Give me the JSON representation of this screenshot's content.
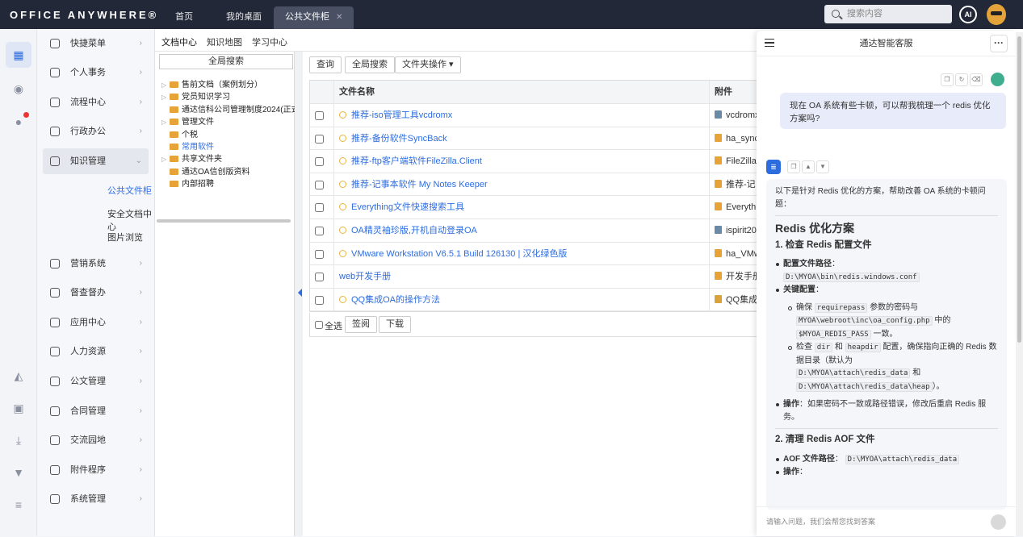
{
  "app": {
    "logo": "OFFICE ANYWHERE®",
    "tabs": [
      "首页",
      "我的桌面",
      "公共文件柜"
    ],
    "active_tab": "公共文件柜",
    "search_placeholder": "搜索内容",
    "ai_label": "AI"
  },
  "menu": {
    "items": [
      {
        "label": "快捷菜单"
      },
      {
        "label": "个人事务"
      },
      {
        "label": "流程中心"
      },
      {
        "label": "行政办公"
      },
      {
        "label": "知识管理"
      },
      {
        "label": "营销系统"
      },
      {
        "label": "督查督办"
      },
      {
        "label": "应用中心"
      },
      {
        "label": "人力资源"
      },
      {
        "label": "公文管理"
      },
      {
        "label": "合同管理"
      },
      {
        "label": "交流园地"
      },
      {
        "label": "附件程序"
      },
      {
        "label": "系统管理"
      }
    ],
    "sub_items": [
      "公共文件柜",
      "安全文档中心",
      "图片浏览"
    ]
  },
  "subtabs": [
    "文档中心",
    "知识地图",
    "学习中心"
  ],
  "tree": {
    "global_search": "全局搜索",
    "nodes": [
      "售前文档（案例划分）",
      "党员知识学习",
      "通达信科公司管理制度2024(正式",
      "管理文件",
      "个税",
      "常用软件",
      "共享文件夹",
      "通达OA信创版资料",
      "内部招聘"
    ]
  },
  "toolbar": {
    "query": "查询",
    "global_search": "全局搜索",
    "folder_ops": "文件夹操作 ▾"
  },
  "table": {
    "headers": [
      "文件名称",
      "附件"
    ],
    "rows": [
      {
        "name": "推荐-iso管理工具vcdromx",
        "att": "vcdromx"
      },
      {
        "name": "推荐-备份软件SyncBack",
        "att": "ha_sync"
      },
      {
        "name": "推荐-ftp客户端软件FileZilla.Client",
        "att": "FileZilla."
      },
      {
        "name": "推荐-记事本软件 My Notes Keeper",
        "att": "推荐-记"
      },
      {
        "name": "Everything文件快速搜索工具",
        "att": "Everythi"
      },
      {
        "name": "OA精灵袖珍版,开机自动登录OA",
        "att": "ispirit20"
      },
      {
        "name": "VMware Workstation V6.5.1 Build 126130 | 汉化绿色版",
        "att": "ha_VMw"
      },
      {
        "name": "web开发手册",
        "att": "开发手册"
      },
      {
        "name": "QQ集成OA的操作方法",
        "att": "QQ集成"
      }
    ],
    "select_all": "全选",
    "sign": "签阅",
    "download": "下载"
  },
  "chat": {
    "title": "通达智能客服",
    "user_msg": "现在 OA 系统有些卡顿，可以帮我梳理一个 redis 优化方案吗?",
    "bot_intro": "以下是针对 Redis 优化的方案，帮助改善 OA 系统的卡顿问题：",
    "h1": "Redis 优化方案",
    "s1_title": "1. 检查 Redis 配置文件",
    "cfg_path_label": "配置文件路径",
    "cfg_path": "D:\\MYOA\\bin\\redis.windows.conf",
    "key_cfg": "关键配置",
    "b1_pre": "确保",
    "b1_code1": "requirepass",
    "b1_mid": "参数的密码与",
    "b1_code2": "MYOA\\webroot\\inc\\oa_config.php",
    "b1_mid2": "中的",
    "b1_code3": "$MYOA_REDIS_PASS",
    "b1_end": "一致。",
    "b2_pre": "检查",
    "b2_code1": "dir",
    "b2_and": "和",
    "b2_code2": "heapdir",
    "b2_mid": "配置，确保指向正确的 Redis 数据目录（默认为",
    "b2_code3": "D:\\MYOA\\attach\\redis_data",
    "b2_and2": "和",
    "b2_code4": "D:\\MYOA\\attach\\redis_data\\heap",
    "b2_end": "）。",
    "op_label": "操作",
    "op_text": "如果密码不一致或路径错误，修改后重启 Redis 服务。",
    "s2_title": "2. 清理 Redis AOF 文件",
    "aof_label": "AOF 文件路径",
    "aof_path": "D:\\MYOA\\attach\\redis_data",
    "op2_label": "操作",
    "input_placeholder": "请输入问题，我们会帮您找到答案"
  },
  "colors": {
    "topbar": "#232838",
    "accent": "#2d6cdf",
    "folder": "#e8a338"
  }
}
